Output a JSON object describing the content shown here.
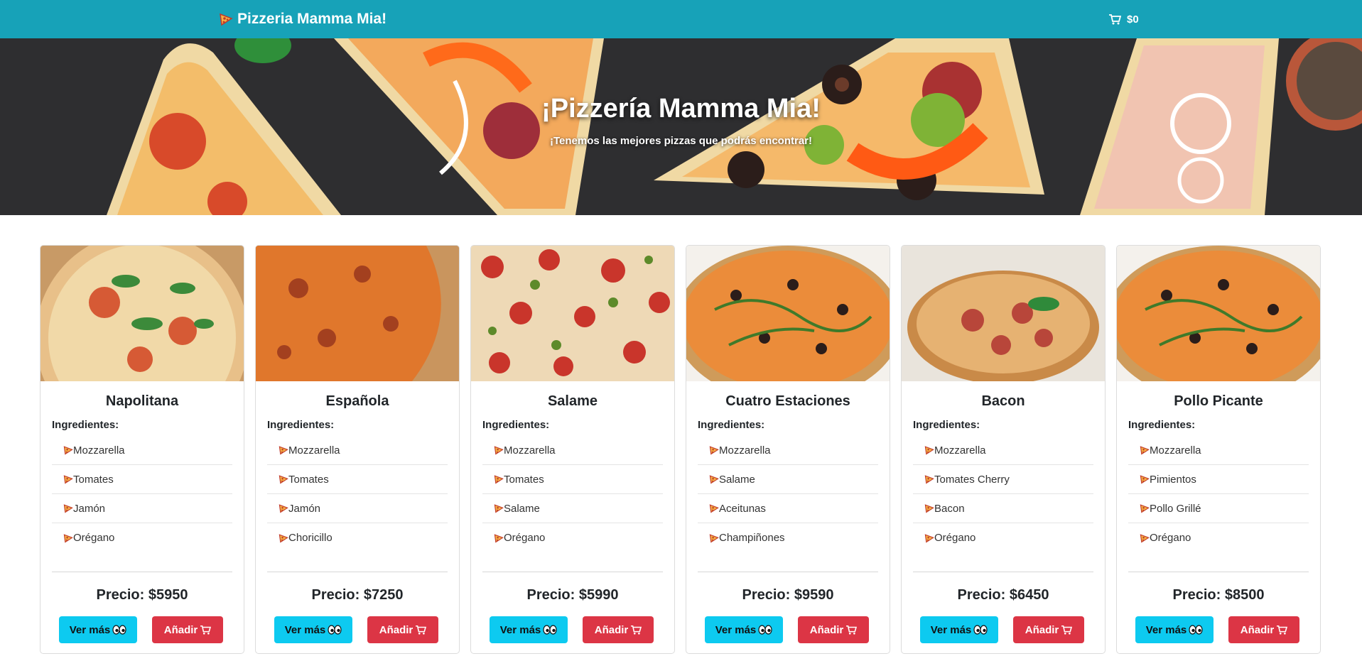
{
  "navbar": {
    "brand": "Pizzeria Mamma Mia!",
    "cart_total": "$0",
    "brand_icon": "pizza-icon",
    "cart_icon": "cart-icon"
  },
  "hero": {
    "title": "¡Pizzería Mamma Mia!",
    "subtitle": "¡Tenemos las mejores pizzas que podrás encontrar!"
  },
  "labels": {
    "ingredients": "Ingredientes:",
    "see_more": "Ver más",
    "add": "Añadir"
  },
  "colors": {
    "navbar": "#17a2b8",
    "info_button": "#0dcaf0",
    "add_button": "#dc3545"
  },
  "pizzas": [
    {
      "name": "Napolitana",
      "price": "Precio: $5950",
      "ingredients": [
        "Mozzarella",
        "Tomates",
        "Jamón",
        "Orégano"
      ]
    },
    {
      "name": "Española",
      "price": "Precio: $7250",
      "ingredients": [
        "Mozzarella",
        "Tomates",
        "Jamón",
        "Choricillo"
      ]
    },
    {
      "name": "Salame",
      "price": "Precio: $5990",
      "ingredients": [
        "Mozzarella",
        "Tomates",
        "Salame",
        "Orégano"
      ]
    },
    {
      "name": "Cuatro Estaciones",
      "price": "Precio: $9590",
      "ingredients": [
        "Mozzarella",
        "Salame",
        "Aceitunas",
        "Champiñones"
      ]
    },
    {
      "name": "Bacon",
      "price": "Precio: $6450",
      "ingredients": [
        "Mozzarella",
        "Tomates Cherry",
        "Bacon",
        "Orégano"
      ]
    },
    {
      "name": "Pollo Picante",
      "price": "Precio: $8500",
      "ingredients": [
        "Mozzarella",
        "Pimientos",
        "Pollo Grillé",
        "Orégano"
      ]
    }
  ]
}
